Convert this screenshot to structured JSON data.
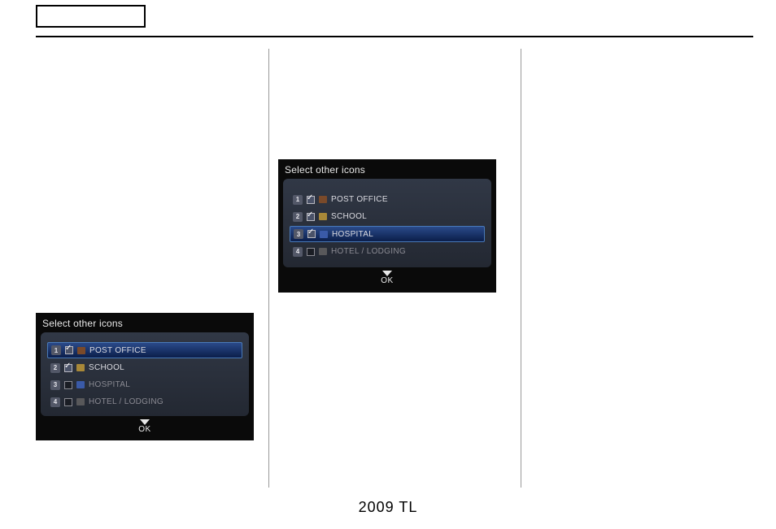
{
  "footer": "2009  TL",
  "device1": {
    "title": "Select other icons",
    "ok": "OK",
    "items": [
      {
        "num": "1",
        "checked": true,
        "iconClass": "post",
        "label": "POST OFFICE"
      },
      {
        "num": "2",
        "checked": true,
        "iconClass": "school",
        "label": "SCHOOL"
      },
      {
        "num": "3",
        "checked": false,
        "iconClass": "hosp",
        "label": "HOSPITAL"
      },
      {
        "num": "4",
        "checked": false,
        "iconClass": "hotel",
        "label": "HOTEL / LODGING"
      }
    ],
    "selectedIndex": 0
  },
  "device2": {
    "title": "Select other icons",
    "ok": "OK",
    "items": [
      {
        "num": "1",
        "checked": true,
        "iconClass": "post",
        "label": "POST OFFICE"
      },
      {
        "num": "2",
        "checked": true,
        "iconClass": "school",
        "label": "SCHOOL"
      },
      {
        "num": "3",
        "checked": true,
        "iconClass": "hosp",
        "label": "HOSPITAL"
      },
      {
        "num": "4",
        "checked": false,
        "iconClass": "hotel",
        "label": "HOTEL / LODGING"
      }
    ],
    "selectedIndex": 2
  }
}
